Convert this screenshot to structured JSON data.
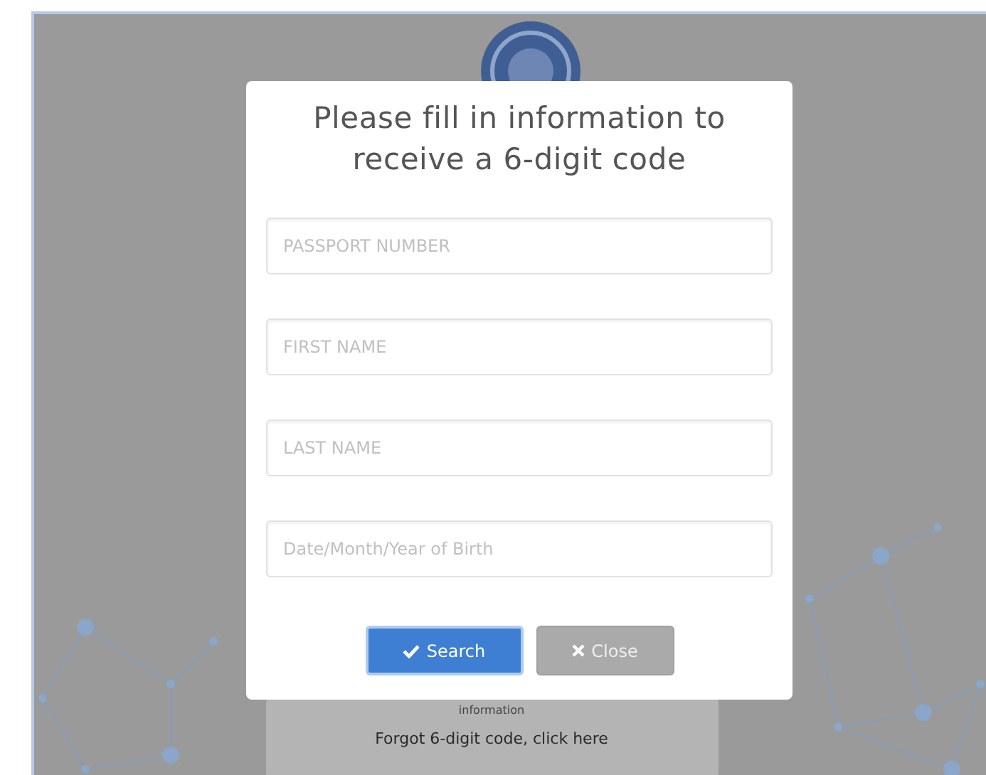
{
  "background_page": {
    "card_caption": "information",
    "forgot_link": "Forgot 6-digit code, click here"
  },
  "modal": {
    "title": "Please fill in information to receive a 6-digit code",
    "fields": [
      {
        "placeholder": "PASSPORT NUMBER"
      },
      {
        "placeholder": "FIRST NAME"
      },
      {
        "placeholder": "LAST NAME"
      },
      {
        "placeholder": "Date/Month/Year of Birth"
      }
    ],
    "buttons": [
      {
        "kind": "primary",
        "label": "Search"
      },
      {
        "kind": "secondary",
        "label": "Close"
      }
    ]
  }
}
